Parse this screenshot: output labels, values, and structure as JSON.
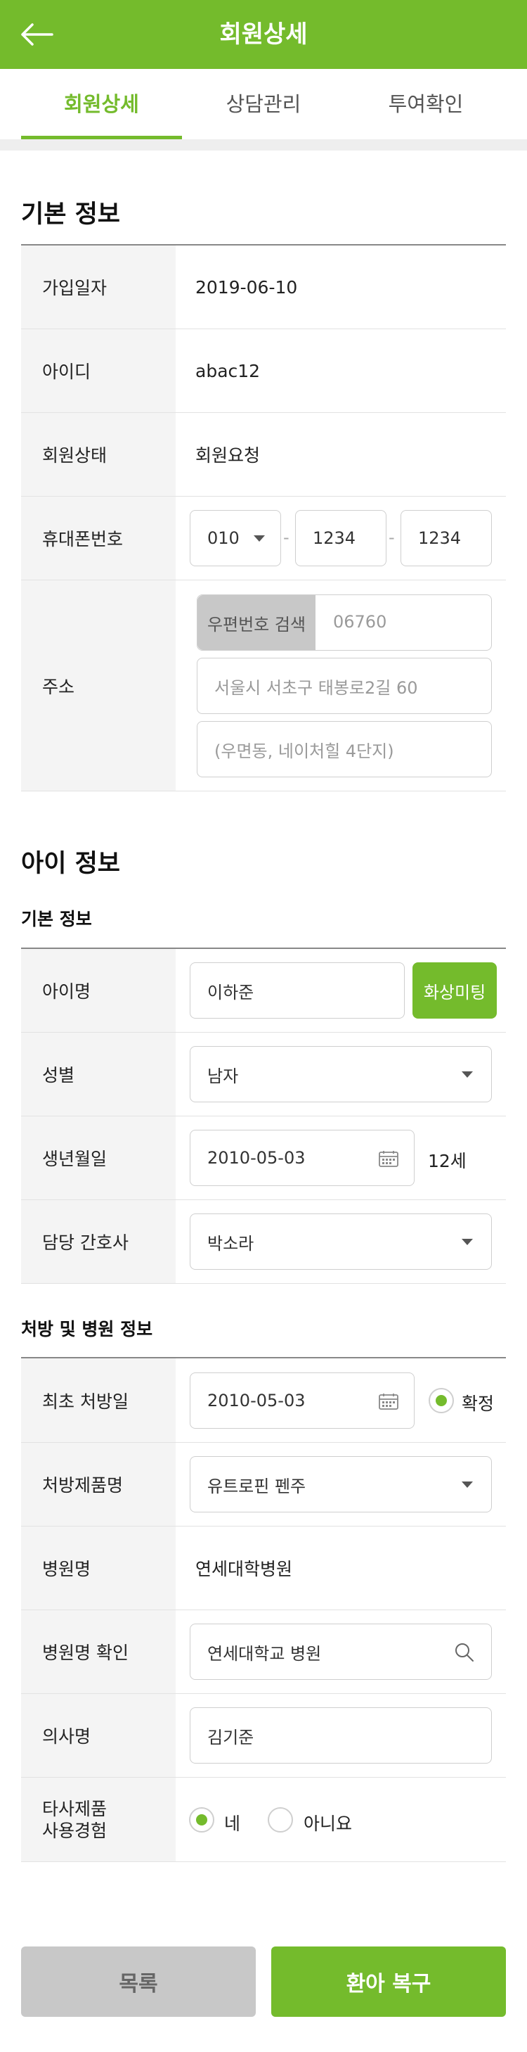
{
  "header": {
    "title": "회원상세",
    "back_icon": "arrow-left-icon"
  },
  "tabs": [
    {
      "label": "회원상세",
      "active": true
    },
    {
      "label": "상담관리",
      "active": false
    },
    {
      "label": "투여확인",
      "active": false
    }
  ],
  "basic": {
    "section_title": "기본 정보",
    "join_date": {
      "label": "가입일자",
      "value": "2019-06-10"
    },
    "user_id": {
      "label": "아이디",
      "value": "abac12"
    },
    "status": {
      "label": "회원상태",
      "value": "회원요청"
    },
    "phone": {
      "label": "휴대폰번호",
      "prefix": "010",
      "middle": "1234",
      "last": "1234"
    },
    "address": {
      "label": "주소",
      "search_button": "우편번호 검색",
      "zip_placeholder": "06760",
      "line1_placeholder": "서울시 서초구 태봉로2길 60",
      "line2_placeholder": "(우면동, 네이처힐 4단지)"
    }
  },
  "child": {
    "section_title": "아이 정보",
    "basic_title": "기본 정보",
    "name": {
      "label": "아이명",
      "value": "이하준",
      "button": "화상미팅"
    },
    "gender": {
      "label": "성별",
      "value": "남자"
    },
    "birth": {
      "label": "생년월일",
      "value": "2010-05-03",
      "age": "12세"
    },
    "nurse": {
      "label": "담당 간호사",
      "value": "박소라"
    },
    "prescription_title": "처방 및 병원 정보",
    "first_rx": {
      "label": "최초 처방일",
      "value": "2010-05-03",
      "confirm_label": "확정",
      "confirmed": true
    },
    "product": {
      "label": "처방제품명",
      "value": "유트로핀 펜주"
    },
    "hospital": {
      "label": "병원명",
      "value": "연세대학병원"
    },
    "hospital_check": {
      "label": "병원명 확인",
      "value": "연세대학교 병원"
    },
    "doctor": {
      "label": "의사명",
      "value": "김기준"
    },
    "other_product": {
      "label_line1": "타사제품",
      "label_line2": "사용경험",
      "yes": "네",
      "no": "아니요",
      "selected": "네"
    }
  },
  "footer": {
    "list_button": "목록",
    "restore_button": "환아 복구"
  },
  "colors": {
    "accent": "#74bb2c",
    "gray_button": "#c8c8c8",
    "label_bg": "#f4f4f4"
  }
}
